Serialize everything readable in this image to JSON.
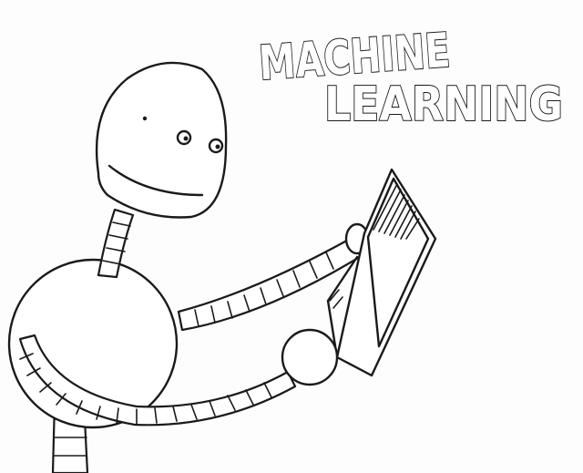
{
  "title": {
    "line1": "MACHINE",
    "line2": "LEARNING"
  },
  "illustration": {
    "subject": "robot-reading-book",
    "ink_color": "#1a1a1a",
    "paper_color": "#ffffff"
  }
}
